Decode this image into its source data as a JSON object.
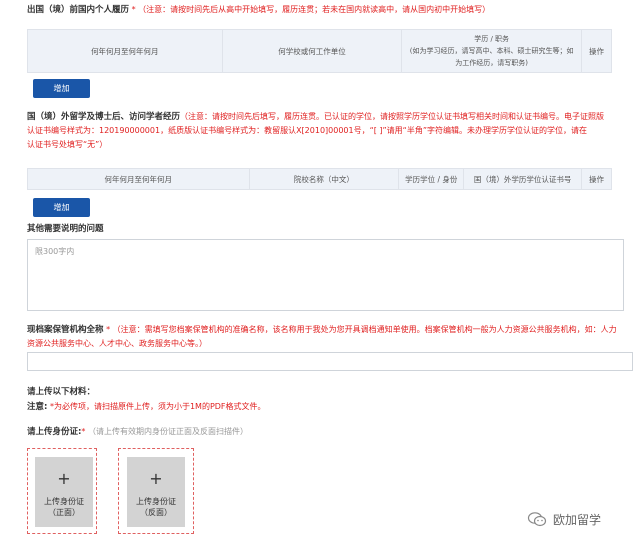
{
  "section1": {
    "title": "出国（境）前国内个人履历",
    "asterisk": "*",
    "note": "（注意：请按时间先后从高中开始填写，履历连贯；若未在国内就读高中，请从国内初中开始填写）",
    "columns": [
      "何年何月至何年何月",
      "何学校或何工作单位"
    ],
    "col3_title": "学历 / 职务",
    "col3_note": "(如为学习经历，请写高中、本科、硕士研究生等；如为工作经历，请写职务)",
    "col4": "操作",
    "add_button": "增加"
  },
  "section2": {
    "title": "国（境）外留学及博士后、访问学者经历",
    "note_line1": "（注意：请按时间先后填写，履历连贯。已认证的学位，请按照学历学位认证书填写相关时间和认证书编号。电子证照版",
    "note_line2": "认证书编号样式为：120190000001，纸质版认证书编号样式为：教留服认X[2010]00001号，“[ ]”请用“半角”字符编辑。未办理学历学位认证的学位，请在",
    "note_line3": "认证书号处填写“无”）",
    "columns": [
      "何年何月至何年何月",
      "院校名称（中文）",
      "学历学位 / 身份",
      "国（境）外学历学位认证书号",
      "操作"
    ],
    "add_button": "增加"
  },
  "section3": {
    "title": "其他需要说明的问题",
    "placeholder": "限300字内"
  },
  "section4": {
    "title": "现档案保管机构全称",
    "asterisk": "*",
    "note_line1": "（注意：需填写您档案保管机构的准确名称，该名称用于我处为您开具调档通知单使用。档案保管机构一般为人力资源公共服务机构，如：人力",
    "note_line2": "资源公共服务中心、人才中心、政务服务中心等。）"
  },
  "section5": {
    "title": "请上传以下材料：",
    "note_label": "注意:",
    "note_text": "*为必传项，请扫描原件上传，须为小于1M的PDF格式文件。"
  },
  "section6": {
    "title": "请上传身份证:",
    "asterisk": "*",
    "hint": "（请上传有效期内身份证正面及反面扫描件）",
    "card_front_line1": "上传身份证",
    "card_front_line2": "（正面）",
    "card_back_line1": "上传身份证",
    "card_back_line2": "（反面）",
    "plus": "+"
  },
  "watermark": "欧加留学"
}
